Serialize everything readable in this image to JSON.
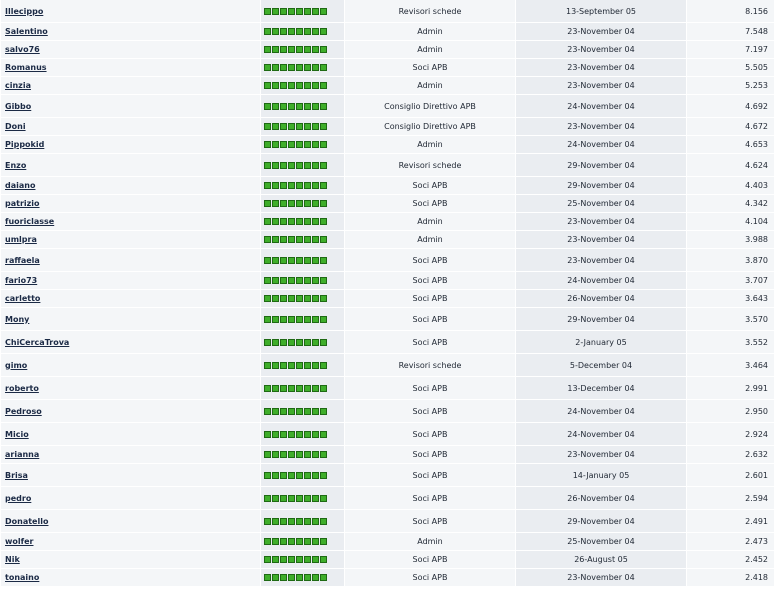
{
  "rank_pips": 8,
  "colors": {
    "pip_fill": "#3fae2a",
    "pip_border": "#1f6a14",
    "link": "#1b2a45"
  },
  "rows": [
    {
      "name": "Illecippo",
      "group": "Revisori schede",
      "date": "13-September 05",
      "score": "8.156"
    },
    {
      "name": "Salentino",
      "group": "Admin",
      "date": "23-November 04",
      "score": "7.548"
    },
    {
      "name": "salvo76",
      "group": "Admin",
      "date": "23-November 04",
      "score": "7.197"
    },
    {
      "name": "Romanus",
      "group": "Soci APB",
      "date": "23-November 04",
      "score": "5.505"
    },
    {
      "name": "cinzia",
      "group": "Admin",
      "date": "23-November 04",
      "score": "5.253"
    },
    {
      "name": "Gibbo",
      "group": "Consiglio Direttivo APB",
      "date": "24-November 04",
      "score": "4.692"
    },
    {
      "name": "Doni",
      "group": "Consiglio Direttivo APB",
      "date": "23-November 04",
      "score": "4.672"
    },
    {
      "name": "Pippokid",
      "group": "Admin",
      "date": "24-November 04",
      "score": "4.653"
    },
    {
      "name": "Enzo",
      "group": "Revisori schede",
      "date": "29-November 04",
      "score": "4.624"
    },
    {
      "name": "daiano",
      "group": "Soci APB",
      "date": "29-November 04",
      "score": "4.403"
    },
    {
      "name": "patrizio",
      "group": "Soci APB",
      "date": "25-November 04",
      "score": "4.342"
    },
    {
      "name": "fuoriclasse",
      "group": "Admin",
      "date": "23-November 04",
      "score": "4.104"
    },
    {
      "name": "umlpra",
      "group": "Admin",
      "date": "23-November 04",
      "score": "3.988"
    },
    {
      "name": "raffaela",
      "group": "Soci APB",
      "date": "23-November 04",
      "score": "3.870"
    },
    {
      "name": "fario73",
      "group": "Soci APB",
      "date": "24-November 04",
      "score": "3.707"
    },
    {
      "name": "carletto",
      "group": "Soci APB",
      "date": "26-November 04",
      "score": "3.643"
    },
    {
      "name": "Mony",
      "group": "Soci APB",
      "date": "29-November 04",
      "score": "3.570"
    },
    {
      "name": "ChiCercaTrova",
      "group": "Soci APB",
      "date": "2-January 05",
      "score": "3.552"
    },
    {
      "name": "gimo",
      "group": "Revisori schede",
      "date": "5-December 04",
      "score": "3.464"
    },
    {
      "name": "roberto",
      "group": "Soci APB",
      "date": "13-December 04",
      "score": "2.991"
    },
    {
      "name": "Pedroso",
      "group": "Soci APB",
      "date": "24-November 04",
      "score": "2.950"
    },
    {
      "name": "Micio",
      "group": "Soci APB",
      "date": "24-November 04",
      "score": "2.924"
    },
    {
      "name": "arianna",
      "group": "Soci APB",
      "date": "23-November 04",
      "score": "2.632"
    },
    {
      "name": "Brisa",
      "group": "Soci APB",
      "date": "14-January 05",
      "score": "2.601"
    },
    {
      "name": "pedro",
      "group": "Soci APB",
      "date": "26-November 04",
      "score": "2.594"
    },
    {
      "name": "Donatello",
      "group": "Soci APB",
      "date": "29-November 04",
      "score": "2.491"
    },
    {
      "name": "wolfer",
      "group": "Admin",
      "date": "25-November 04",
      "score": "2.473"
    },
    {
      "name": "Nik",
      "group": "Soci APB",
      "date": "26-August 05",
      "score": "2.452"
    },
    {
      "name": "tonaino",
      "group": "Soci APB",
      "date": "23-November 04",
      "score": "2.418"
    }
  ]
}
